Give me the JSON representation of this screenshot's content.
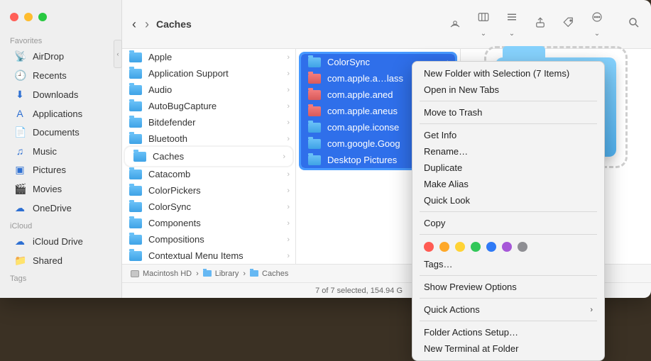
{
  "header": {
    "title": "Caches"
  },
  "sidebar": {
    "sections": [
      {
        "label": "Favorites",
        "items": [
          "AirDrop",
          "Recents",
          "Downloads",
          "Applications",
          "Documents",
          "Music",
          "Pictures",
          "Movies",
          "OneDrive"
        ]
      },
      {
        "label": "iCloud",
        "items": [
          "iCloud Drive",
          "Shared"
        ]
      },
      {
        "label": "Tags",
        "items": []
      }
    ]
  },
  "col1": {
    "items": [
      "Apple",
      "Application Support",
      "Audio",
      "AutoBugCapture",
      "Bitdefender",
      "Bluetooth",
      "Caches",
      "Catacomb",
      "ColorPickers",
      "ColorSync",
      "Components",
      "Compositions",
      "Contextual Menu Items"
    ],
    "highlight_index": 6
  },
  "col2": {
    "items": [
      {
        "name": "ColorSync",
        "red": false
      },
      {
        "name": "com.apple.a…lass",
        "red": true
      },
      {
        "name": "com.apple.aned",
        "red": true
      },
      {
        "name": "com.apple.aneus",
        "red": true
      },
      {
        "name": "com.apple.iconse",
        "red": false
      },
      {
        "name": "com.google.Goog",
        "red": false
      },
      {
        "name": "Desktop Pictures",
        "red": false
      }
    ]
  },
  "path_bar": {
    "segments": [
      "Macintosh HD",
      "Library",
      "Caches"
    ]
  },
  "status": "7 of 7 selected, 154.94 G",
  "context_menu": {
    "items": [
      {
        "label": "New Folder with Selection (7 Items)"
      },
      {
        "label": "Open in New Tabs"
      },
      {
        "sep": true
      },
      {
        "label": "Move to Trash"
      },
      {
        "sep": true
      },
      {
        "label": "Get Info"
      },
      {
        "label": "Rename…"
      },
      {
        "label": "Duplicate"
      },
      {
        "label": "Make Alias"
      },
      {
        "label": "Quick Look"
      },
      {
        "sep": true
      },
      {
        "label": "Copy"
      },
      {
        "sep": true
      },
      {
        "tags": true
      },
      {
        "label": "Tags…"
      },
      {
        "sep": true
      },
      {
        "label": "Show Preview Options"
      },
      {
        "sep": true
      },
      {
        "label": "Quick Actions",
        "submenu": true
      },
      {
        "sep": true
      },
      {
        "label": "Folder Actions Setup…"
      },
      {
        "label": "New Terminal at Folder"
      }
    ]
  }
}
